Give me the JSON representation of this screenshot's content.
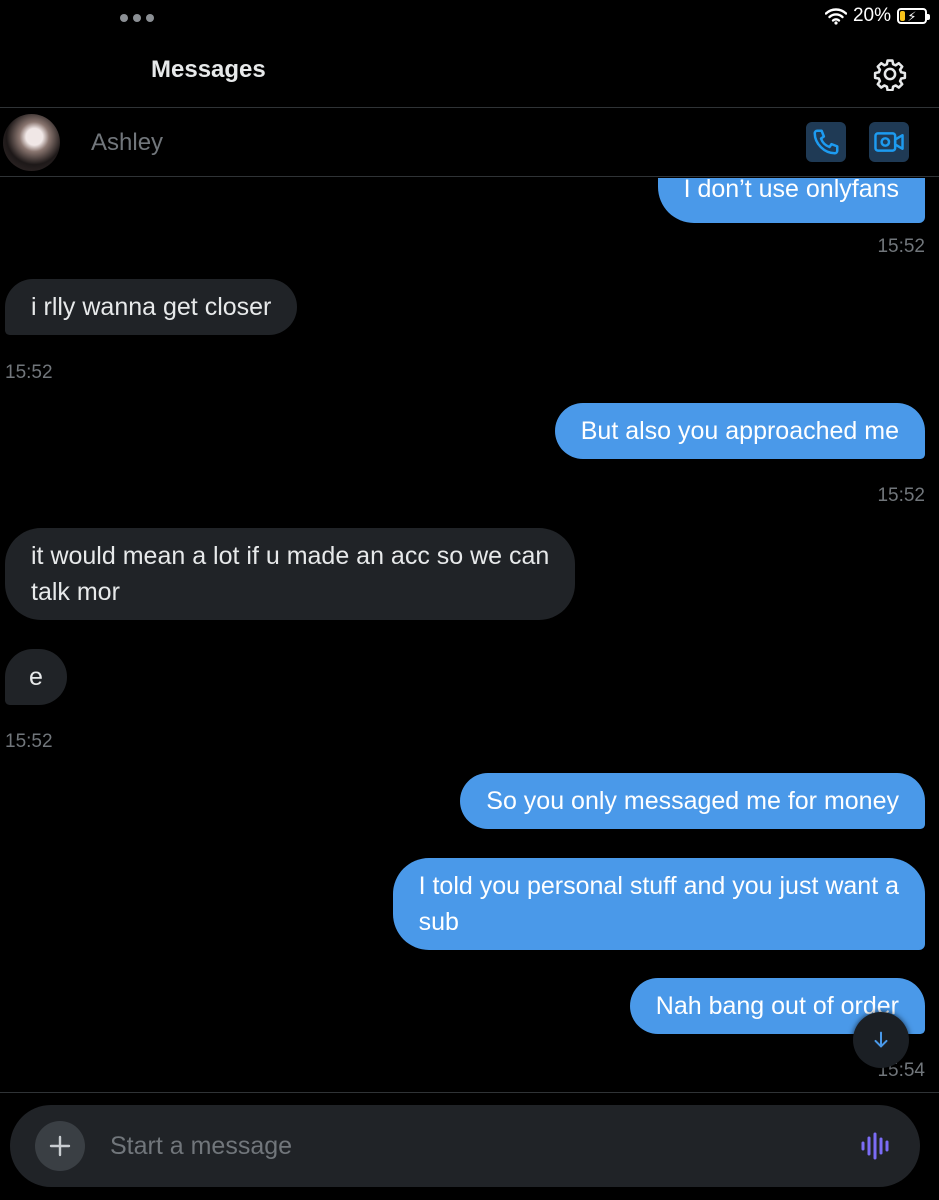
{
  "status_bar": {
    "battery_text": "20%",
    "battery_level": 0.2,
    "bolt_icon": "charging-bolt-icon"
  },
  "header": {
    "title": "Messages",
    "settings_icon": "gear-icon"
  },
  "contact": {
    "name": "Ashley",
    "call_icon": "phone-icon",
    "video_icon": "video-icon"
  },
  "messages": [
    {
      "direction": "out",
      "text": "I don’t use onlyfans",
      "time": "15:52"
    },
    {
      "direction": "in",
      "text": "i rlly wanna get closer",
      "time": "15:52"
    },
    {
      "direction": "out",
      "text": "But also you approached me",
      "time": "15:52"
    },
    {
      "direction": "in",
      "text": "it would mean a lot if u made an acc so we can\ntalk mor"
    },
    {
      "direction": "in",
      "text": "e",
      "time": "15:52"
    },
    {
      "direction": "out",
      "text": "So you only messaged me for money"
    },
    {
      "direction": "out",
      "text": "I told you personal stuff and you just want a\nsub"
    },
    {
      "direction": "out",
      "text": "Nah bang out of order",
      "time": "15:54"
    }
  ],
  "composer": {
    "placeholder": "Start a message",
    "add_icon": "plus-icon",
    "voice_icon": "voice-waveform-icon"
  },
  "colors": {
    "outgoing_bubble": "#4a99e9",
    "incoming_bubble": "#202327",
    "background": "#000000",
    "accent": "#4a99e9",
    "voice_accent": "#7b6cf6"
  }
}
